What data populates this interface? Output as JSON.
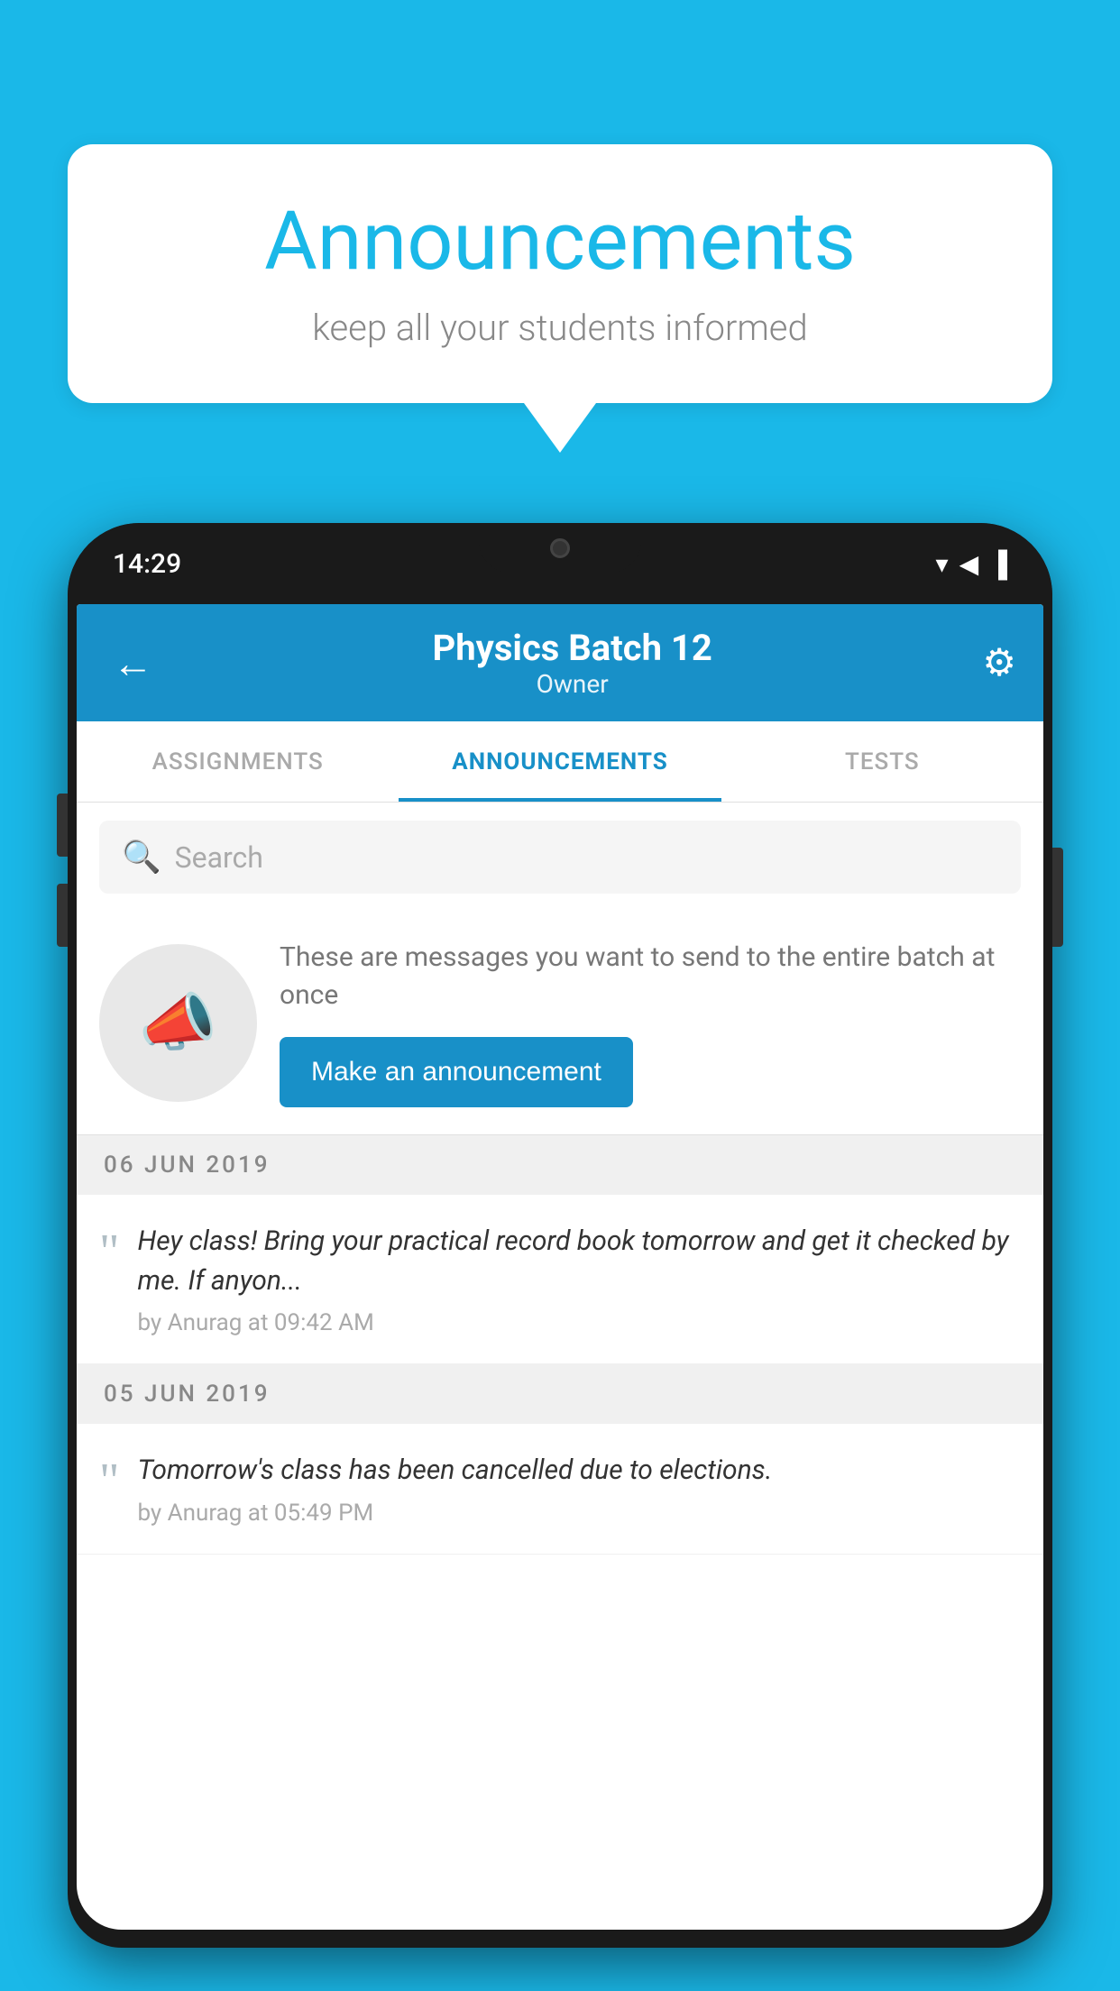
{
  "background_color": "#1ab8e8",
  "speech_bubble": {
    "title": "Announcements",
    "subtitle": "keep all your students informed"
  },
  "phone": {
    "status_bar": {
      "time": "14:29",
      "wifi": "▾",
      "signal": "▲",
      "battery": "▐"
    },
    "app_bar": {
      "title": "Physics Batch 12",
      "subtitle": "Owner",
      "back_label": "←",
      "settings_label": "⚙"
    },
    "tabs": [
      {
        "label": "ASSIGNMENTS",
        "active": false
      },
      {
        "label": "ANNOUNCEMENTS",
        "active": true
      },
      {
        "label": "TESTS",
        "active": false
      }
    ],
    "search": {
      "placeholder": "Search",
      "icon": "🔍"
    },
    "announcement_promo": {
      "description": "These are messages you want to send to the entire batch at once",
      "button_label": "Make an announcement"
    },
    "messages": [
      {
        "date_separator": "06  JUN  2019",
        "text": "Hey class! Bring your practical record book tomorrow and get it checked by me. If anyon...",
        "meta": "by Anurag at 09:42 AM"
      },
      {
        "date_separator": "05  JUN  2019",
        "text": "Tomorrow's class has been cancelled due to elections.",
        "meta": "by Anurag at 05:49 PM"
      }
    ]
  }
}
